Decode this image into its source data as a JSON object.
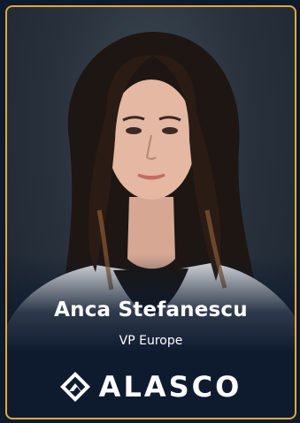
{
  "person": {
    "name": "Anca Stefanescu",
    "title": "VP Europe"
  },
  "brand": {
    "name": "ALASCO",
    "icon": "alasco-logo-icon"
  },
  "colors": {
    "frame_border": "#e0a93a",
    "background": "#0f1a2c",
    "text": "#ffffff"
  }
}
